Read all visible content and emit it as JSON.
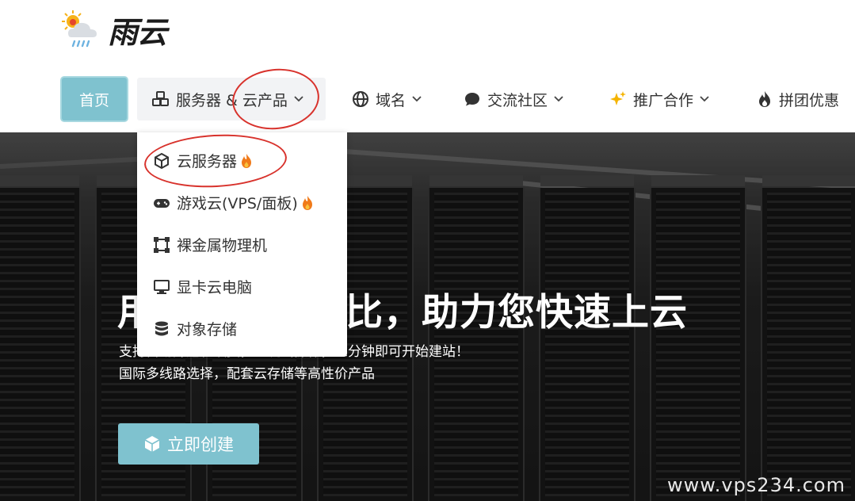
{
  "brand": {
    "name": "雨云",
    "logo_icon": "sun-cloud-rain-icon"
  },
  "nav": {
    "home": "首页",
    "servers": "服务器 & 云产品",
    "domain": "域名",
    "community": "交流社区",
    "promo": "推广合作",
    "group": "拼团优惠"
  },
  "dropdown": {
    "items": [
      {
        "label": "云服务器",
        "icon": "cube-icon",
        "hot": true
      },
      {
        "label": "游戏云(VPS/面板)",
        "icon": "gamepad-icon",
        "hot": true
      },
      {
        "label": "裸金属物理机",
        "icon": "bare-metal-icon",
        "hot": false
      },
      {
        "label": "显卡云电脑",
        "icon": "monitor-icon",
        "hot": false
      },
      {
        "label": "对象存储",
        "icon": "database-icon",
        "hot": false
      }
    ]
  },
  "hero": {
    "title": "用稳定和性价比，助力您快速上云",
    "subtitle_line1": "支持自动开通和续费，一键式操作，三分钟即可开始建站！",
    "subtitle_line2": "国际多线路选择，配套云存储等高性价产品",
    "cta": "立即创建"
  },
  "watermark": "www.vps234.com",
  "colors": {
    "accent": "#7fc2cf",
    "annotation": "#d8322c",
    "flame": "#f07a1a"
  }
}
